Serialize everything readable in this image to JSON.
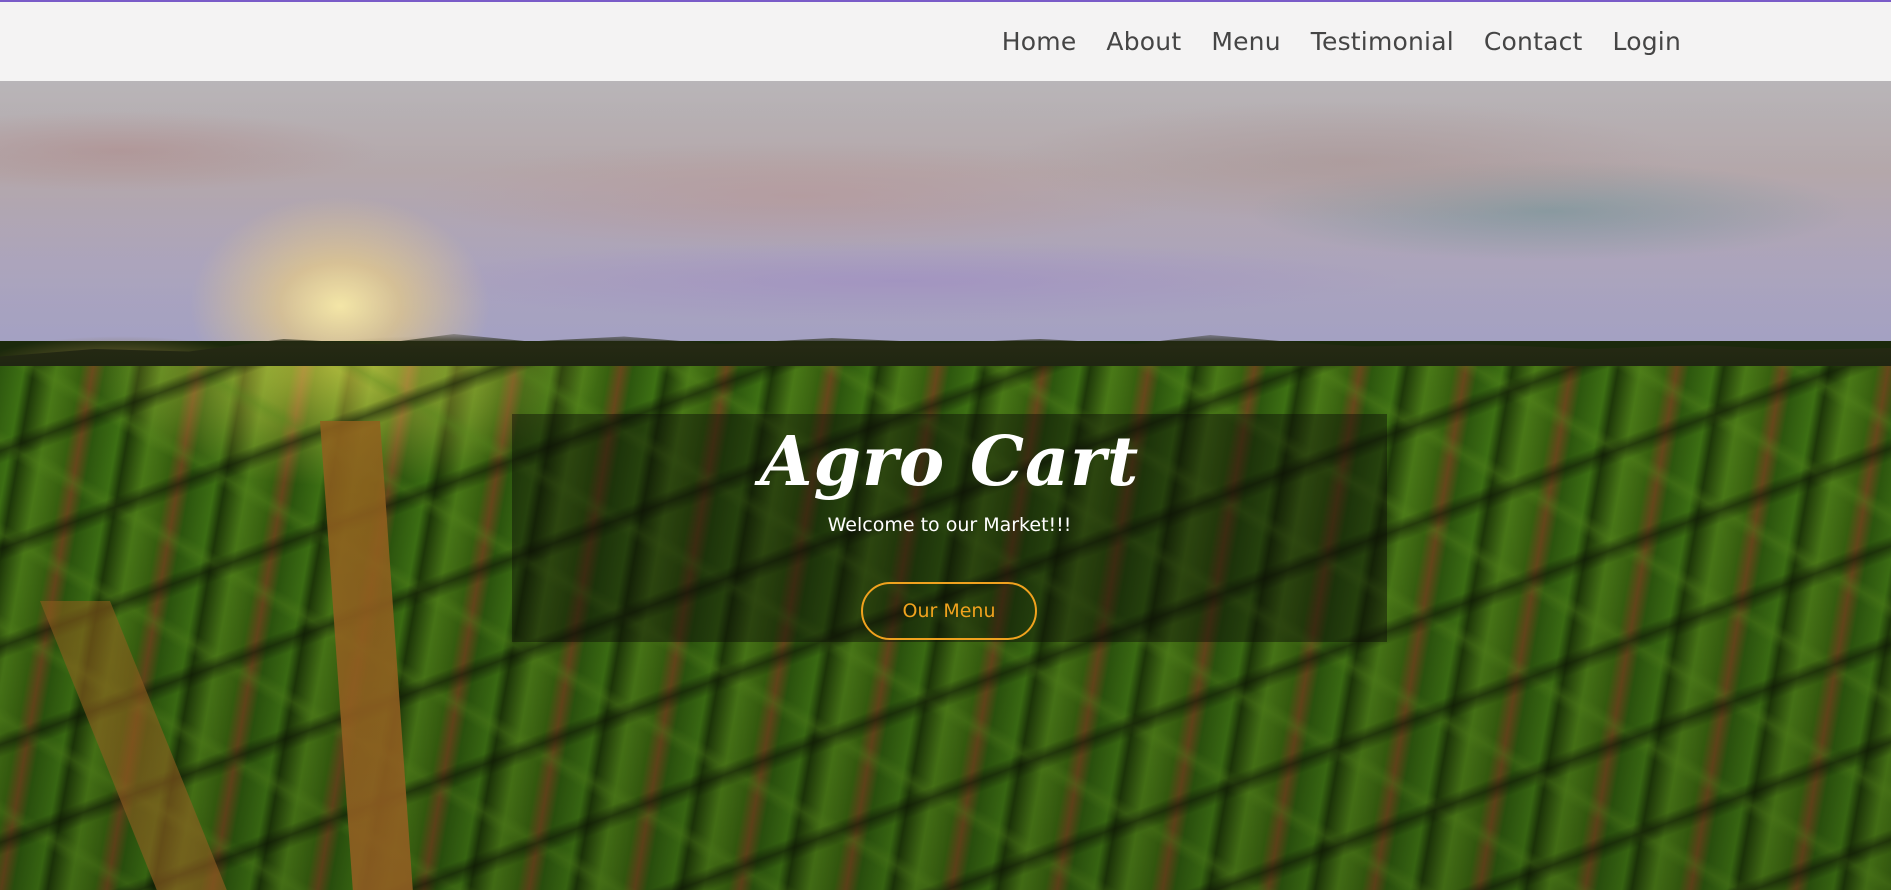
{
  "navbar": {
    "links": [
      {
        "label": "Home"
      },
      {
        "label": "About"
      },
      {
        "label": "Menu"
      },
      {
        "label": "Testimonial"
      },
      {
        "label": "Contact"
      },
      {
        "label": "Login"
      }
    ]
  },
  "hero": {
    "title": "Agro Cart",
    "tagline": "Welcome to our Market!!!",
    "cta_label": "Our Menu"
  },
  "colors": {
    "accent": "#f0a21e",
    "navbar_bg": "#f4f3f3",
    "nav_text": "#454545",
    "top_border": "#7a5bc8"
  }
}
